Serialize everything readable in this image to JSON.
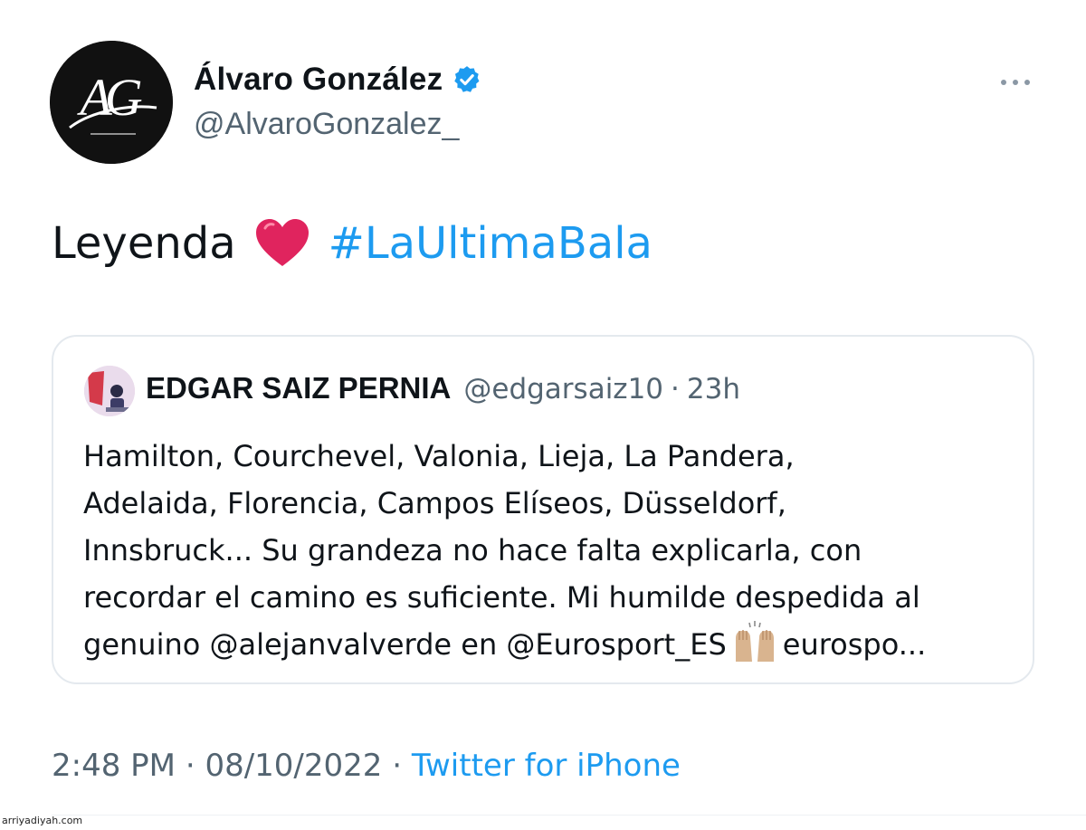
{
  "author": {
    "display_name": "Álvaro González",
    "handle": "@AlvaroGonzalez_",
    "verified": true,
    "avatar_monogram": "AG"
  },
  "tweet": {
    "text": "Leyenda",
    "emoji": "heart-icon",
    "hashtag": "#LaUltimaBala"
  },
  "quoted_tweet": {
    "display_name": "EDGAR SAIZ PERNIA",
    "handle": "@edgarsaiz10",
    "separator": "·",
    "time": "23h",
    "lines": [
      "Hamilton, Courchevel, Valonia, Lieja, La Pandera,",
      "Adelaida, Florencia, Campos Elíseos, Düsseldorf,",
      "Innsbruck... Su grandeza no hace falta explicarla, con",
      "recordar el camino es suficiente. Mi humilde despedida al"
    ],
    "last_line_before_emoji": "genuino @alejanvalverde en @Eurosport_ES",
    "last_line_after_emoji": "eurospo...",
    "inline_emoji": "raised-hands-icon"
  },
  "meta": {
    "time": "2:48 PM",
    "separator": "·",
    "date": "08/10/2022",
    "source": "Twitter for iPhone"
  },
  "watermark": "arriyadiyah.com",
  "colors": {
    "link": "#1d9bf0",
    "secondary_text": "#536471",
    "verified": "#1d9bf0",
    "heart": "#e0245e"
  }
}
